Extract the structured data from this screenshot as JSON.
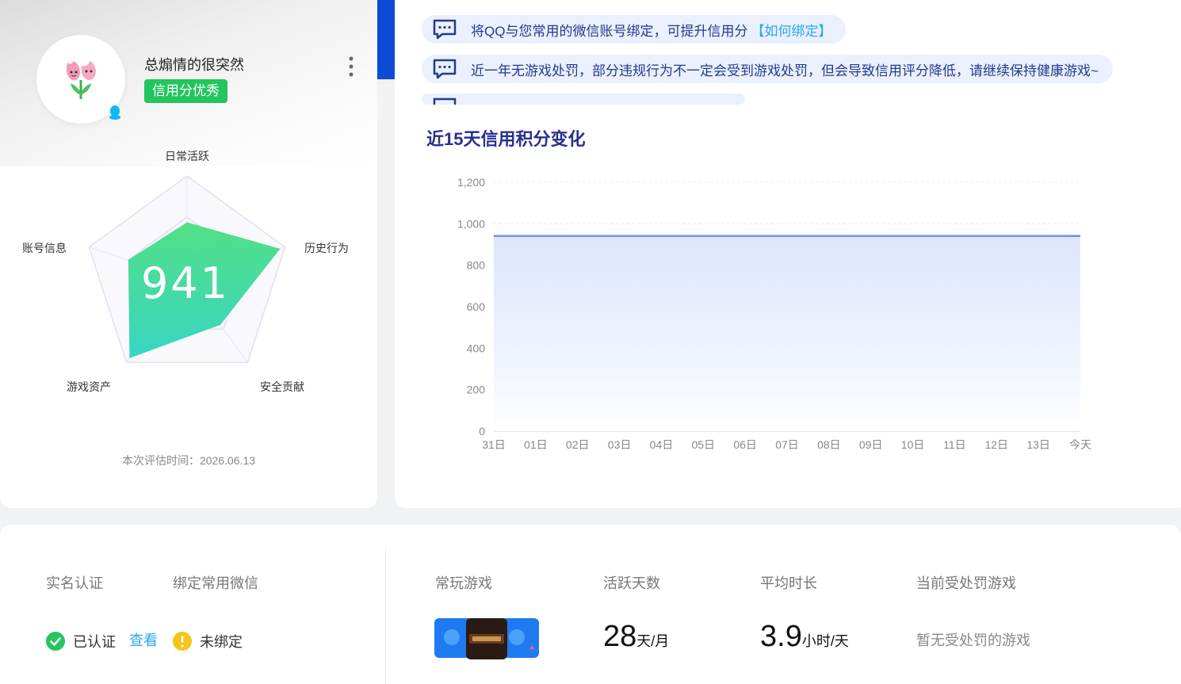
{
  "profile": {
    "nickname": "总煽情的很突然",
    "credit_badge": "信用分优秀",
    "score": "941",
    "eval_time": "本次评估时间：2026.06.13",
    "radar_axes": [
      "日常活跃",
      "历史行为",
      "安全贡献",
      "游戏资产",
      "账号信息"
    ],
    "radar_values": [
      0.55,
      0.95,
      0.55,
      0.95,
      0.6
    ]
  },
  "notices": [
    {
      "text": "将QQ与您常用的微信账号绑定，可提升信用分",
      "link": "【如何绑定】"
    },
    {
      "text": "近一年无游戏处罚，部分违规行为不一定会受到游戏处罚，但会导致信用评分降低，请继续保持健康游戏~",
      "link": ""
    }
  ],
  "chart_title": "近15天信用积分变化",
  "chart_data": {
    "type": "area",
    "title": "近15天信用积分变化",
    "x": [
      "31日",
      "01日",
      "02日",
      "03日",
      "04日",
      "05日",
      "06日",
      "07日",
      "08日",
      "09日",
      "10日",
      "11日",
      "12日",
      "13日",
      "今天"
    ],
    "values": [
      941,
      941,
      941,
      941,
      941,
      941,
      941,
      941,
      941,
      941,
      941,
      941,
      941,
      941,
      941
    ],
    "ylim": [
      0,
      1200
    ],
    "yticks": [
      "0",
      "200",
      "400",
      "600",
      "800",
      "1,000",
      "1,200"
    ],
    "grid": true,
    "color": "#6b8ef0"
  },
  "bottom": {
    "realname_label": "实名认证",
    "wechat_label": "绑定常用微信",
    "realname_status": "已认证",
    "view_link": "查看",
    "wechat_status": "未绑定",
    "games_label": "常玩游戏",
    "active_label": "活跃天数",
    "active_value": "28",
    "active_unit": "天/月",
    "avg_label": "平均时长",
    "avg_value": "3.9",
    "avg_unit": "小时/天",
    "punish_label": "当前受处罚游戏",
    "punish_value": "暂无受处罚的游戏"
  },
  "colors": {
    "green": "#22c55e",
    "blue_link": "#2aa6f0",
    "title": "#2b2f8f",
    "warn": "#f5c518"
  }
}
